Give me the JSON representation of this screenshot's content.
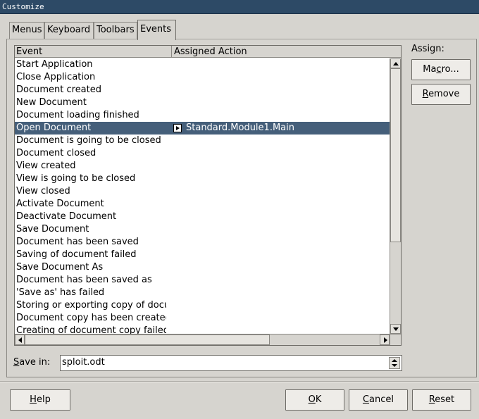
{
  "window": {
    "title": "Customize"
  },
  "tabs": [
    {
      "label": "Menus",
      "active": false
    },
    {
      "label": "Keyboard",
      "active": false
    },
    {
      "label": "Toolbars",
      "active": false
    },
    {
      "label": "Events",
      "active": true
    }
  ],
  "events_list": {
    "columns": [
      "Event",
      "Assigned Action"
    ],
    "rows": [
      {
        "event": "Start Application",
        "action": ""
      },
      {
        "event": "Close Application",
        "action": ""
      },
      {
        "event": "Document created",
        "action": ""
      },
      {
        "event": "New Document",
        "action": ""
      },
      {
        "event": "Document loading finished",
        "action": ""
      },
      {
        "event": "Open Document",
        "action": "Standard.Module1.Main",
        "selected": true,
        "icon": "macro-icon"
      },
      {
        "event": "Document is going to be closed",
        "action": ""
      },
      {
        "event": "Document closed",
        "action": ""
      },
      {
        "event": "View created",
        "action": ""
      },
      {
        "event": "View is going to be closed",
        "action": ""
      },
      {
        "event": "View closed",
        "action": ""
      },
      {
        "event": "Activate Document",
        "action": ""
      },
      {
        "event": "Deactivate Document",
        "action": ""
      },
      {
        "event": "Save Document",
        "action": ""
      },
      {
        "event": "Document has been saved",
        "action": ""
      },
      {
        "event": "Saving of document failed",
        "action": ""
      },
      {
        "event": "Save Document As",
        "action": ""
      },
      {
        "event": "Document has been saved as",
        "action": ""
      },
      {
        "event": "'Save as' has failed",
        "action": ""
      },
      {
        "event": "Storing or exporting copy of document",
        "action": ""
      },
      {
        "event": "Document copy has been created",
        "action": ""
      },
      {
        "event": "Creating of document copy failed",
        "action": ""
      }
    ]
  },
  "assign": {
    "label": "Assign:",
    "macro_button": {
      "pre": "Ma",
      "accel": "c",
      "post": "ro..."
    },
    "remove_button": {
      "pre": "",
      "accel": "R",
      "post": "emove"
    }
  },
  "save_in": {
    "label_accel": "S",
    "label_rest": "ave in:",
    "value": "sploit.odt"
  },
  "footer": {
    "help": {
      "accel": "H",
      "rest": "elp"
    },
    "ok": {
      "accel": "O",
      "rest": "K"
    },
    "cancel": {
      "accel": "C",
      "rest": "ancel"
    },
    "reset": {
      "accel": "R",
      "rest": "eset"
    }
  },
  "colors": {
    "titlebar": "#2d4a66",
    "selection": "#455f7a",
    "dialog_bg": "#d6d4cf"
  }
}
